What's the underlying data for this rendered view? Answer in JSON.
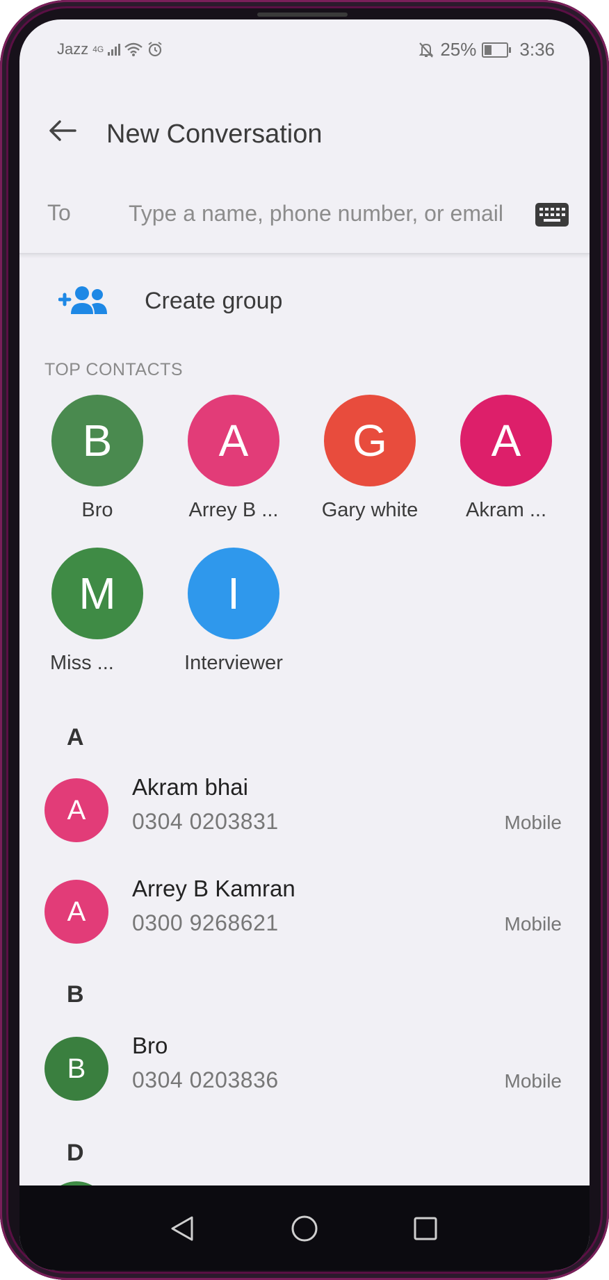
{
  "status_bar": {
    "carrier": "Jazz",
    "network": "4G",
    "battery": "25%",
    "time": "3:36"
  },
  "app_bar": {
    "back_icon": "arrow-left-icon",
    "title": "New Conversation"
  },
  "to_field": {
    "label": "To",
    "placeholder": "Type a name, phone number, or email",
    "value": "",
    "keyboard_icon": "keyboard-icon"
  },
  "create_group": {
    "icon": "add-group-icon",
    "label": "Create group",
    "icon_color": "#1e88e5"
  },
  "top_contacts": {
    "label": "TOP CONTACTS",
    "items": [
      {
        "initial": "B",
        "name": "Bro",
        "color": "#4a8a4f"
      },
      {
        "initial": "A",
        "name": "Arrey B ...",
        "color": "#e23c78"
      },
      {
        "initial": "G",
        "name": "Gary white",
        "color": "#e84c3d"
      },
      {
        "initial": "A",
        "name": "Akram ...",
        "color": "#dd1f6a"
      },
      {
        "initial": "M",
        "name": "Miss ...",
        "color": "#3f8b45"
      },
      {
        "initial": "I",
        "name": "Interviewer",
        "color": "#2f98ec"
      }
    ]
  },
  "contacts": {
    "sections": [
      {
        "letter": "A",
        "items": [
          {
            "initial": "A",
            "name": "Akram bhai",
            "phone": "0304 0203831",
            "type": "Mobile",
            "color": "#e23c78"
          },
          {
            "initial": "A",
            "name": "Arrey B Kamran",
            "phone": "0300 9268621",
            "type": "Mobile",
            "color": "#e23c78"
          }
        ]
      },
      {
        "letter": "B",
        "items": [
          {
            "initial": "B",
            "name": "Bro",
            "phone": "0304 0203836",
            "type": "Mobile",
            "color": "#3a7f3f"
          }
        ]
      },
      {
        "letter": "D",
        "items": []
      }
    ]
  },
  "nav_bar": {
    "back_icon": "triangle-back-icon",
    "home_icon": "circle-home-icon",
    "recents_icon": "square-recents-icon"
  }
}
